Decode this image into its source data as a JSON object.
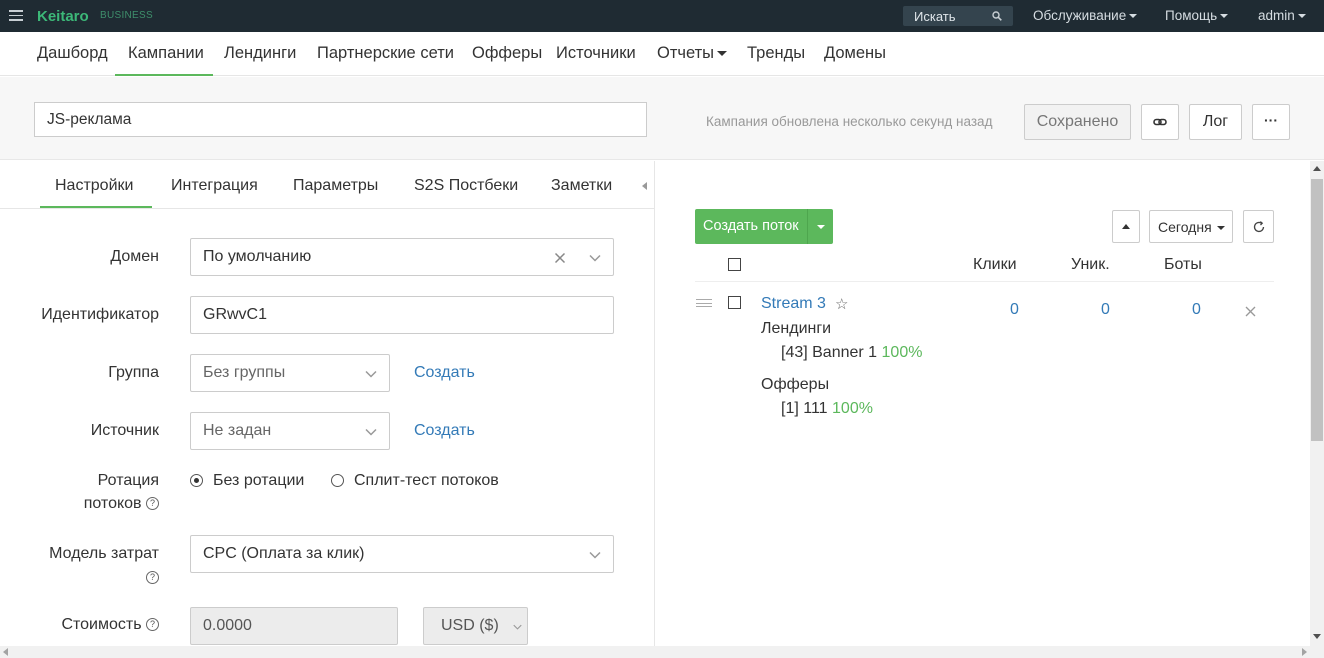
{
  "topbar": {
    "logo": "Keitaro",
    "edition": "BUSINESS",
    "search_placeholder": "Искать",
    "menu": [
      "Обслуживание",
      "Помощь",
      "admin"
    ]
  },
  "nav": {
    "items": [
      "Дашборд",
      "Кампании",
      "Лендинги",
      "Партнерские сети",
      "Офферы",
      "Источники",
      "Отчеты",
      "Тренды",
      "Домены"
    ],
    "active": "Кампании"
  },
  "campaign": {
    "name": "JS-реклама",
    "status": "Кампания обновлена несколько секунд назад",
    "saved_label": "Сохранено",
    "log_label": "Лог",
    "more_label": "···"
  },
  "settings": {
    "tabs": [
      "Настройки",
      "Интеграция",
      "Параметры",
      "S2S Постбеки",
      "Заметки"
    ],
    "active_tab": "Настройки",
    "domain_label": "Домен",
    "domain_value": "По умолчанию",
    "identifier_label": "Идентификатор",
    "identifier_value": "GRwvC1",
    "group_label": "Группа",
    "group_value": "Без группы",
    "source_label": "Источник",
    "source_value": "Не задан",
    "create_label": "Создать",
    "rotation_label_1": "Ротация",
    "rotation_label_2": "потоков",
    "rotation_options": [
      "Без ротации",
      "Сплит-тест потоков"
    ],
    "rotation_selected": "Без ротации",
    "cost_model_label": "Модель затрат",
    "cost_model_value": "CPC (Оплата за клик)",
    "cost_label": "Стоимость",
    "cost_value": "0.0000",
    "currency_value": "USD ($)",
    "help_glyph": "?"
  },
  "streams": {
    "create_label": "Создать поток",
    "period_label": "Сегодня",
    "columns": [
      "Клики",
      "Уник.",
      "Боты"
    ],
    "rows": [
      {
        "name": "Stream 3",
        "clicks": "0",
        "unique": "0",
        "bots": "0",
        "landings_title": "Лендинги",
        "landing_item": "[43] Banner 1",
        "landing_pct": "100%",
        "offers_title": "Офферы",
        "offer_item": "[1] 111",
        "offer_pct": "100%"
      }
    ]
  },
  "colors": {
    "topbar_bg": "#1f2b33",
    "accent_green": "#5cb85c",
    "link_blue": "#337ab7"
  }
}
